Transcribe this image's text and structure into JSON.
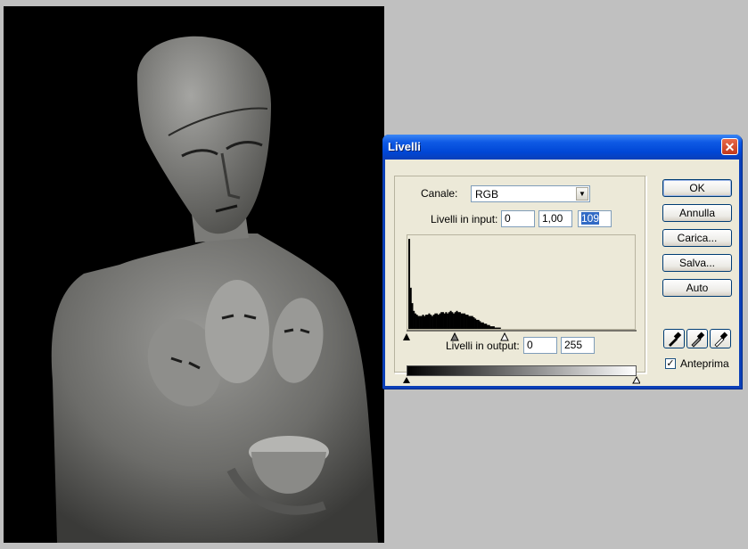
{
  "dialog": {
    "title": "Livelli",
    "close_icon": "close-icon",
    "channel": {
      "label": "Canale:",
      "value": "RGB"
    },
    "input_levels": {
      "label": "Livelli in input:",
      "black": "0",
      "gamma": "1,00",
      "white": "109"
    },
    "output_levels": {
      "label": "Livelli in output:",
      "black": "0",
      "white": "255"
    },
    "buttons": {
      "ok": "OK",
      "cancel": "Annulla",
      "load": "Carica...",
      "save": "Salva...",
      "auto": "Auto"
    },
    "eyedroppers": [
      "black-eyedropper-icon",
      "gray-eyedropper-icon",
      "white-eyedropper-icon"
    ],
    "preview": {
      "label": "Anteprima",
      "checked": true
    }
  },
  "histogram": {
    "channel": "RGB",
    "values": [
      70,
      32,
      20,
      14,
      12,
      11,
      10,
      10,
      10,
      11,
      10,
      11,
      11,
      12,
      11,
      10,
      11,
      12,
      12,
      11,
      12,
      13,
      13,
      12,
      13,
      12,
      13,
      14,
      13,
      12,
      13,
      14,
      13,
      13,
      12,
      12,
      12,
      11,
      11,
      10,
      10,
      10,
      9,
      8,
      7,
      7,
      6,
      5,
      5,
      4,
      4,
      3,
      3,
      2,
      2,
      2,
      1,
      1,
      1,
      1,
      0,
      0,
      0,
      0,
      0,
      0
    ]
  },
  "sliders": {
    "input_black": 0,
    "input_gray": 1.0,
    "input_white": 109,
    "output_black": 0,
    "output_white": 255
  }
}
